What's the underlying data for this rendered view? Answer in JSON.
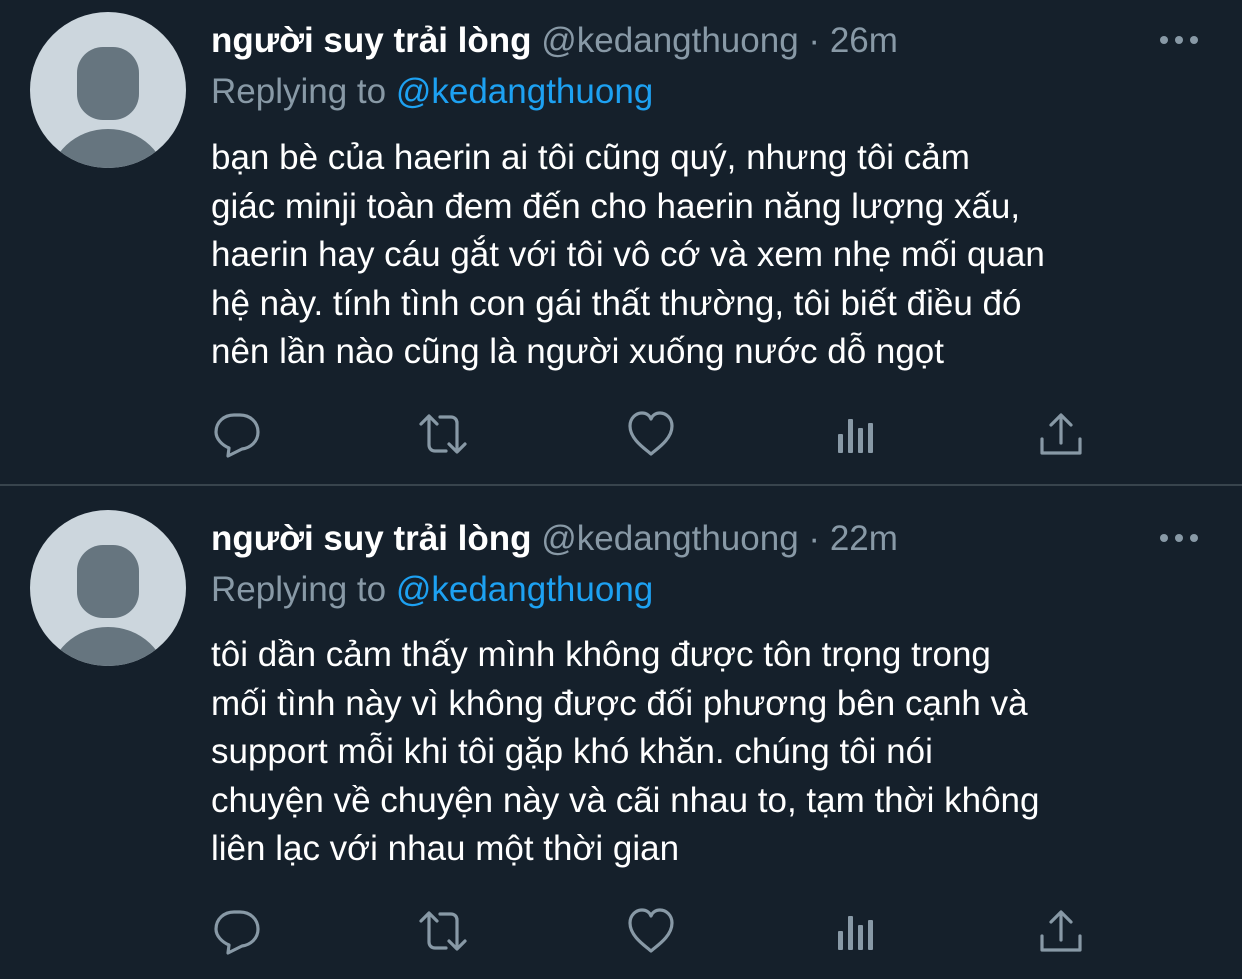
{
  "tweets": [
    {
      "display_name": "người suy trải lòng",
      "handle": "@kedangthuong",
      "separator": "·",
      "time": "26m",
      "replying_prefix": "Replying to",
      "replying_to": "@kedangthuong",
      "body_lines": [
        "bạn bè của haerin ai tôi cũng quý, nhưng tôi cảm",
        "giác minji toàn đem đến cho haerin năng lượng xấu,",
        "haerin hay cáu gắt với tôi vô cớ và xem nhẹ mối quan",
        "hệ này. tính tình con gái thất thường, tôi biết điều đó",
        "nên lần nào cũng là người xuống nước dỗ ngọt"
      ],
      "actions": [
        "reply-icon",
        "retweet-icon",
        "like-icon",
        "analytics-icon",
        "share-icon"
      ]
    },
    {
      "display_name": "người suy trải lòng",
      "handle": "@kedangthuong",
      "separator": "·",
      "time": "22m",
      "replying_prefix": "Replying to",
      "replying_to": "@kedangthuong",
      "body_lines": [
        "tôi dần cảm thấy mình không được tôn trọng trong",
        "mối tình này vì không được đối phương bên cạnh và",
        "support mỗi khi tôi gặp khó khăn. chúng tôi nói",
        "chuyện về chuyện này và cãi nhau to, tạm thời không",
        "liên lạc với nhau một thời gian"
      ],
      "actions": [
        "reply-icon",
        "retweet-icon",
        "like-icon",
        "analytics-icon",
        "share-icon"
      ]
    }
  ],
  "colors": {
    "background": "#15202b",
    "text_primary": "#ffffff",
    "text_secondary": "#8899a6",
    "link": "#1da1f2",
    "divider": "#38444d",
    "avatar_bg": "#ccd6dd",
    "avatar_fg": "#66757f"
  },
  "icons": {
    "more": "more-horizontal-icon",
    "default_avatar": "default-avatar-icon"
  }
}
